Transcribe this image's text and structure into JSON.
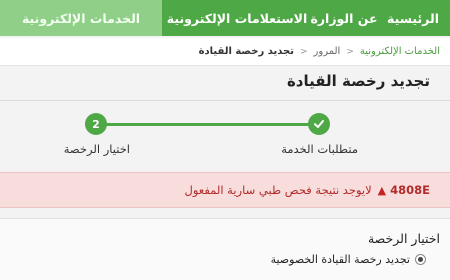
{
  "nav": {
    "items": [
      {
        "label": "الرئيسية"
      },
      {
        "label": "عن الوزارة"
      },
      {
        "label": "الاستعلامات الإلكترونية"
      },
      {
        "label": "الخدمات الإلكترونية"
      }
    ],
    "active_index": 3
  },
  "breadcrumb": {
    "items": [
      "الخدمات الإلكترونية",
      "المرور",
      "تجديد رخصة القيادة"
    ]
  },
  "page": {
    "title": "تجديد رخصة القيادة"
  },
  "steps": [
    {
      "icon": "check-icon",
      "number": "",
      "label": "متطلبات الخدمة",
      "done": true
    },
    {
      "icon": "",
      "number": "2",
      "label": "اختيار الرخصة",
      "done": false
    }
  ],
  "alert": {
    "code": "4808E",
    "icon": "warning-icon",
    "message": "لايوجد نتيجة فحص طبي سارية المفعول"
  },
  "license_section": {
    "title": "اختيار الرخصة",
    "options": [
      {
        "label": "تجديد رخصة القيادة الخصوصية",
        "selected": true
      }
    ]
  },
  "colors": {
    "brand_green": "#4ea845",
    "active_tab": "#8fcf87",
    "alert_bg": "#f8dddd",
    "alert_text": "#b32b2b"
  }
}
